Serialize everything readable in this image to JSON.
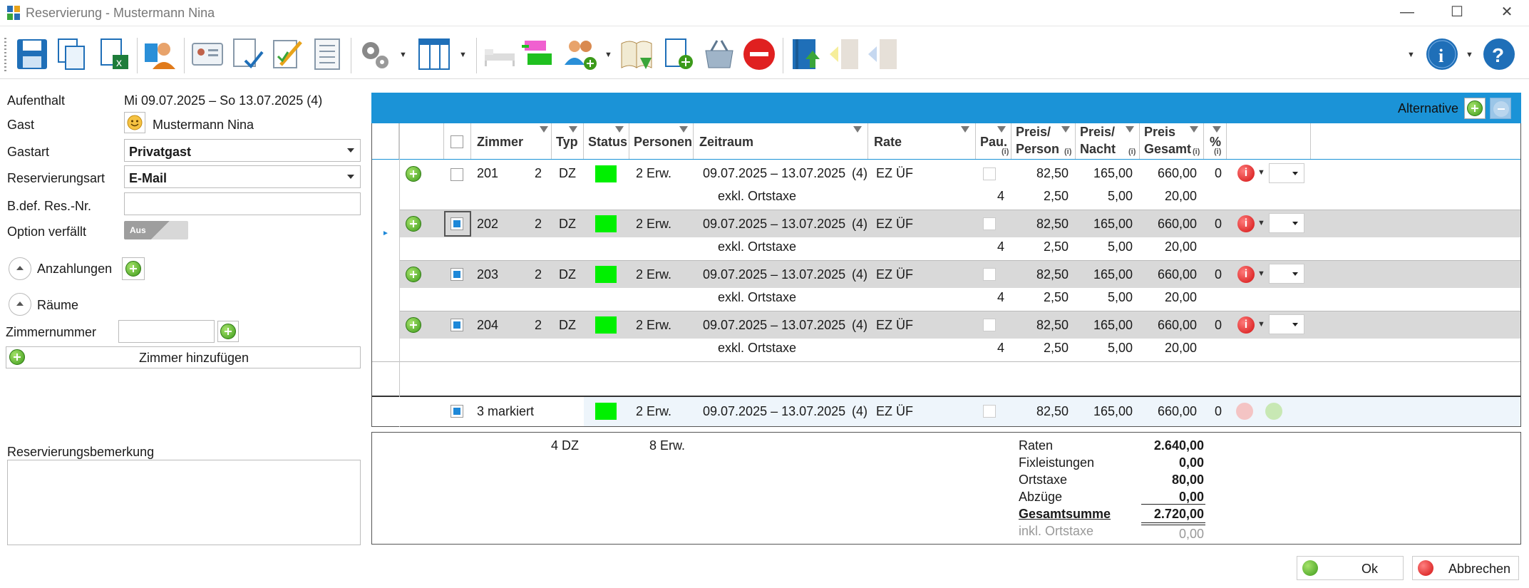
{
  "window": {
    "title": "Reservierung - Mustermann Nina",
    "minimize": "—",
    "maximize": "☐",
    "close": "✕"
  },
  "left": {
    "aufenthalt_label": "Aufenthalt",
    "aufenthalt_value": "Mi 09.07.2025 – So 13.07.2025 (4)",
    "gast_label": "Gast",
    "gast_value": "Mustermann Nina",
    "gastart_label": "Gastart",
    "gastart_value": "Privatgast",
    "resart_label": "Reservierungsart",
    "resart_value": "E-Mail",
    "bdef_label": "B.def. Res.-Nr.",
    "bdef_value": "",
    "option_label": "Option verfällt",
    "option_toggle": "Aus",
    "anzahlungen_label": "Anzahlungen",
    "raeume_label": "Räume",
    "zimmernummer_label": "Zimmernummer",
    "zimmernummer_value": "",
    "zimmer_hinzufuegen": "Zimmer hinzufügen",
    "bemerkung_label": "Reservierungsbemerkung",
    "bemerkung_value": ""
  },
  "grid": {
    "alternative_label": "Alternative",
    "columns": {
      "zimmer": "Zimmer",
      "typ": "Typ",
      "status": "Status",
      "personen": "Personen",
      "zeitraum": "Zeitraum",
      "rate": "Rate",
      "pau": "Pau.",
      "preis_person_1": "Preis/",
      "preis_person_2": "Person",
      "preis_nacht_1": "Preis/",
      "preis_nacht_2": "Nacht",
      "preis_gesamt_1": "Preis",
      "preis_gesamt_2": "Gesamt",
      "pct": "%",
      "info": "(i)"
    },
    "rows": [
      {
        "zimmer": "201",
        "betten": "2",
        "typ": "DZ",
        "personen": "2 Erw.",
        "zeitraum": "09.07.2025 – 13.07.2025",
        "naechte": "(4)",
        "rate": "EZ ÜF",
        "preis_person": "82,50",
        "preis_nacht": "165,00",
        "preis_gesamt": "660,00",
        "pct": "0",
        "sub_label": "exkl. Ortstaxe",
        "sub_pau": "4",
        "sub_person": "2,50",
        "sub_nacht": "5,00",
        "sub_gesamt": "20,00",
        "checked": false,
        "status_color": "#00f000"
      },
      {
        "zimmer": "202",
        "betten": "2",
        "typ": "DZ",
        "personen": "2 Erw.",
        "zeitraum": "09.07.2025 – 13.07.2025",
        "naechte": "(4)",
        "rate": "EZ ÜF",
        "preis_person": "82,50",
        "preis_nacht": "165,00",
        "preis_gesamt": "660,00",
        "pct": "0",
        "sub_label": "exkl. Ortstaxe",
        "sub_pau": "4",
        "sub_person": "2,50",
        "sub_nacht": "5,00",
        "sub_gesamt": "20,00",
        "checked": true,
        "status_color": "#00f000"
      },
      {
        "zimmer": "203",
        "betten": "2",
        "typ": "DZ",
        "personen": "2 Erw.",
        "zeitraum": "09.07.2025 – 13.07.2025",
        "naechte": "(4)",
        "rate": "EZ ÜF",
        "preis_person": "82,50",
        "preis_nacht": "165,00",
        "preis_gesamt": "660,00",
        "pct": "0",
        "sub_label": "exkl. Ortstaxe",
        "sub_pau": "4",
        "sub_person": "2,50",
        "sub_nacht": "5,00",
        "sub_gesamt": "20,00",
        "checked": true,
        "status_color": "#00f000"
      },
      {
        "zimmer": "204",
        "betten": "2",
        "typ": "DZ",
        "personen": "2 Erw.",
        "zeitraum": "09.07.2025 – 13.07.2025",
        "naechte": "(4)",
        "rate": "EZ ÜF",
        "preis_person": "82,50",
        "preis_nacht": "165,00",
        "preis_gesamt": "660,00",
        "pct": "0",
        "sub_label": "exkl. Ortstaxe",
        "sub_pau": "4",
        "sub_person": "2,50",
        "sub_nacht": "5,00",
        "sub_gesamt": "20,00",
        "checked": true,
        "status_color": "#00f000"
      }
    ],
    "marked": {
      "label": "3 markiert",
      "personen": "2 Erw.",
      "zeitraum": "09.07.2025 – 13.07.2025",
      "naechte": "(4)",
      "rate": "EZ ÜF",
      "preis_person": "82,50",
      "preis_nacht": "165,00",
      "preis_gesamt": "660,00",
      "pct": "0"
    }
  },
  "summary": {
    "zimmer_total": "4 DZ",
    "personen_total": "8 Erw.",
    "raten_label": "Raten",
    "raten_value": "2.640,00",
    "fix_label": "Fixleistungen",
    "fix_value": "0,00",
    "ortstaxe_label": "Ortstaxe",
    "ortstaxe_value": "80,00",
    "abzuege_label": "Abzüge",
    "abzuege_value": "0,00",
    "gesamt_label": "Gesamtsumme",
    "gesamt_value": "2.720,00",
    "inkl_label": "inkl.  Ortstaxe",
    "inkl_value": "0,00"
  },
  "buttons": {
    "ok": "Ok",
    "abbrechen": "Abbrechen"
  },
  "icons": [
    "save-icon",
    "copy-icon",
    "excel-export-icon",
    "guest-icon",
    "id-card-icon",
    "document-check-icon",
    "edit-icon",
    "list-icon",
    "settings-icon",
    "table-layout-icon",
    "bed-icon",
    "room-move-icon",
    "add-group-icon",
    "book-icon",
    "new-document-icon",
    "basket-icon",
    "cancel-icon",
    "upload-icon",
    "info-icon",
    "help-icon"
  ]
}
